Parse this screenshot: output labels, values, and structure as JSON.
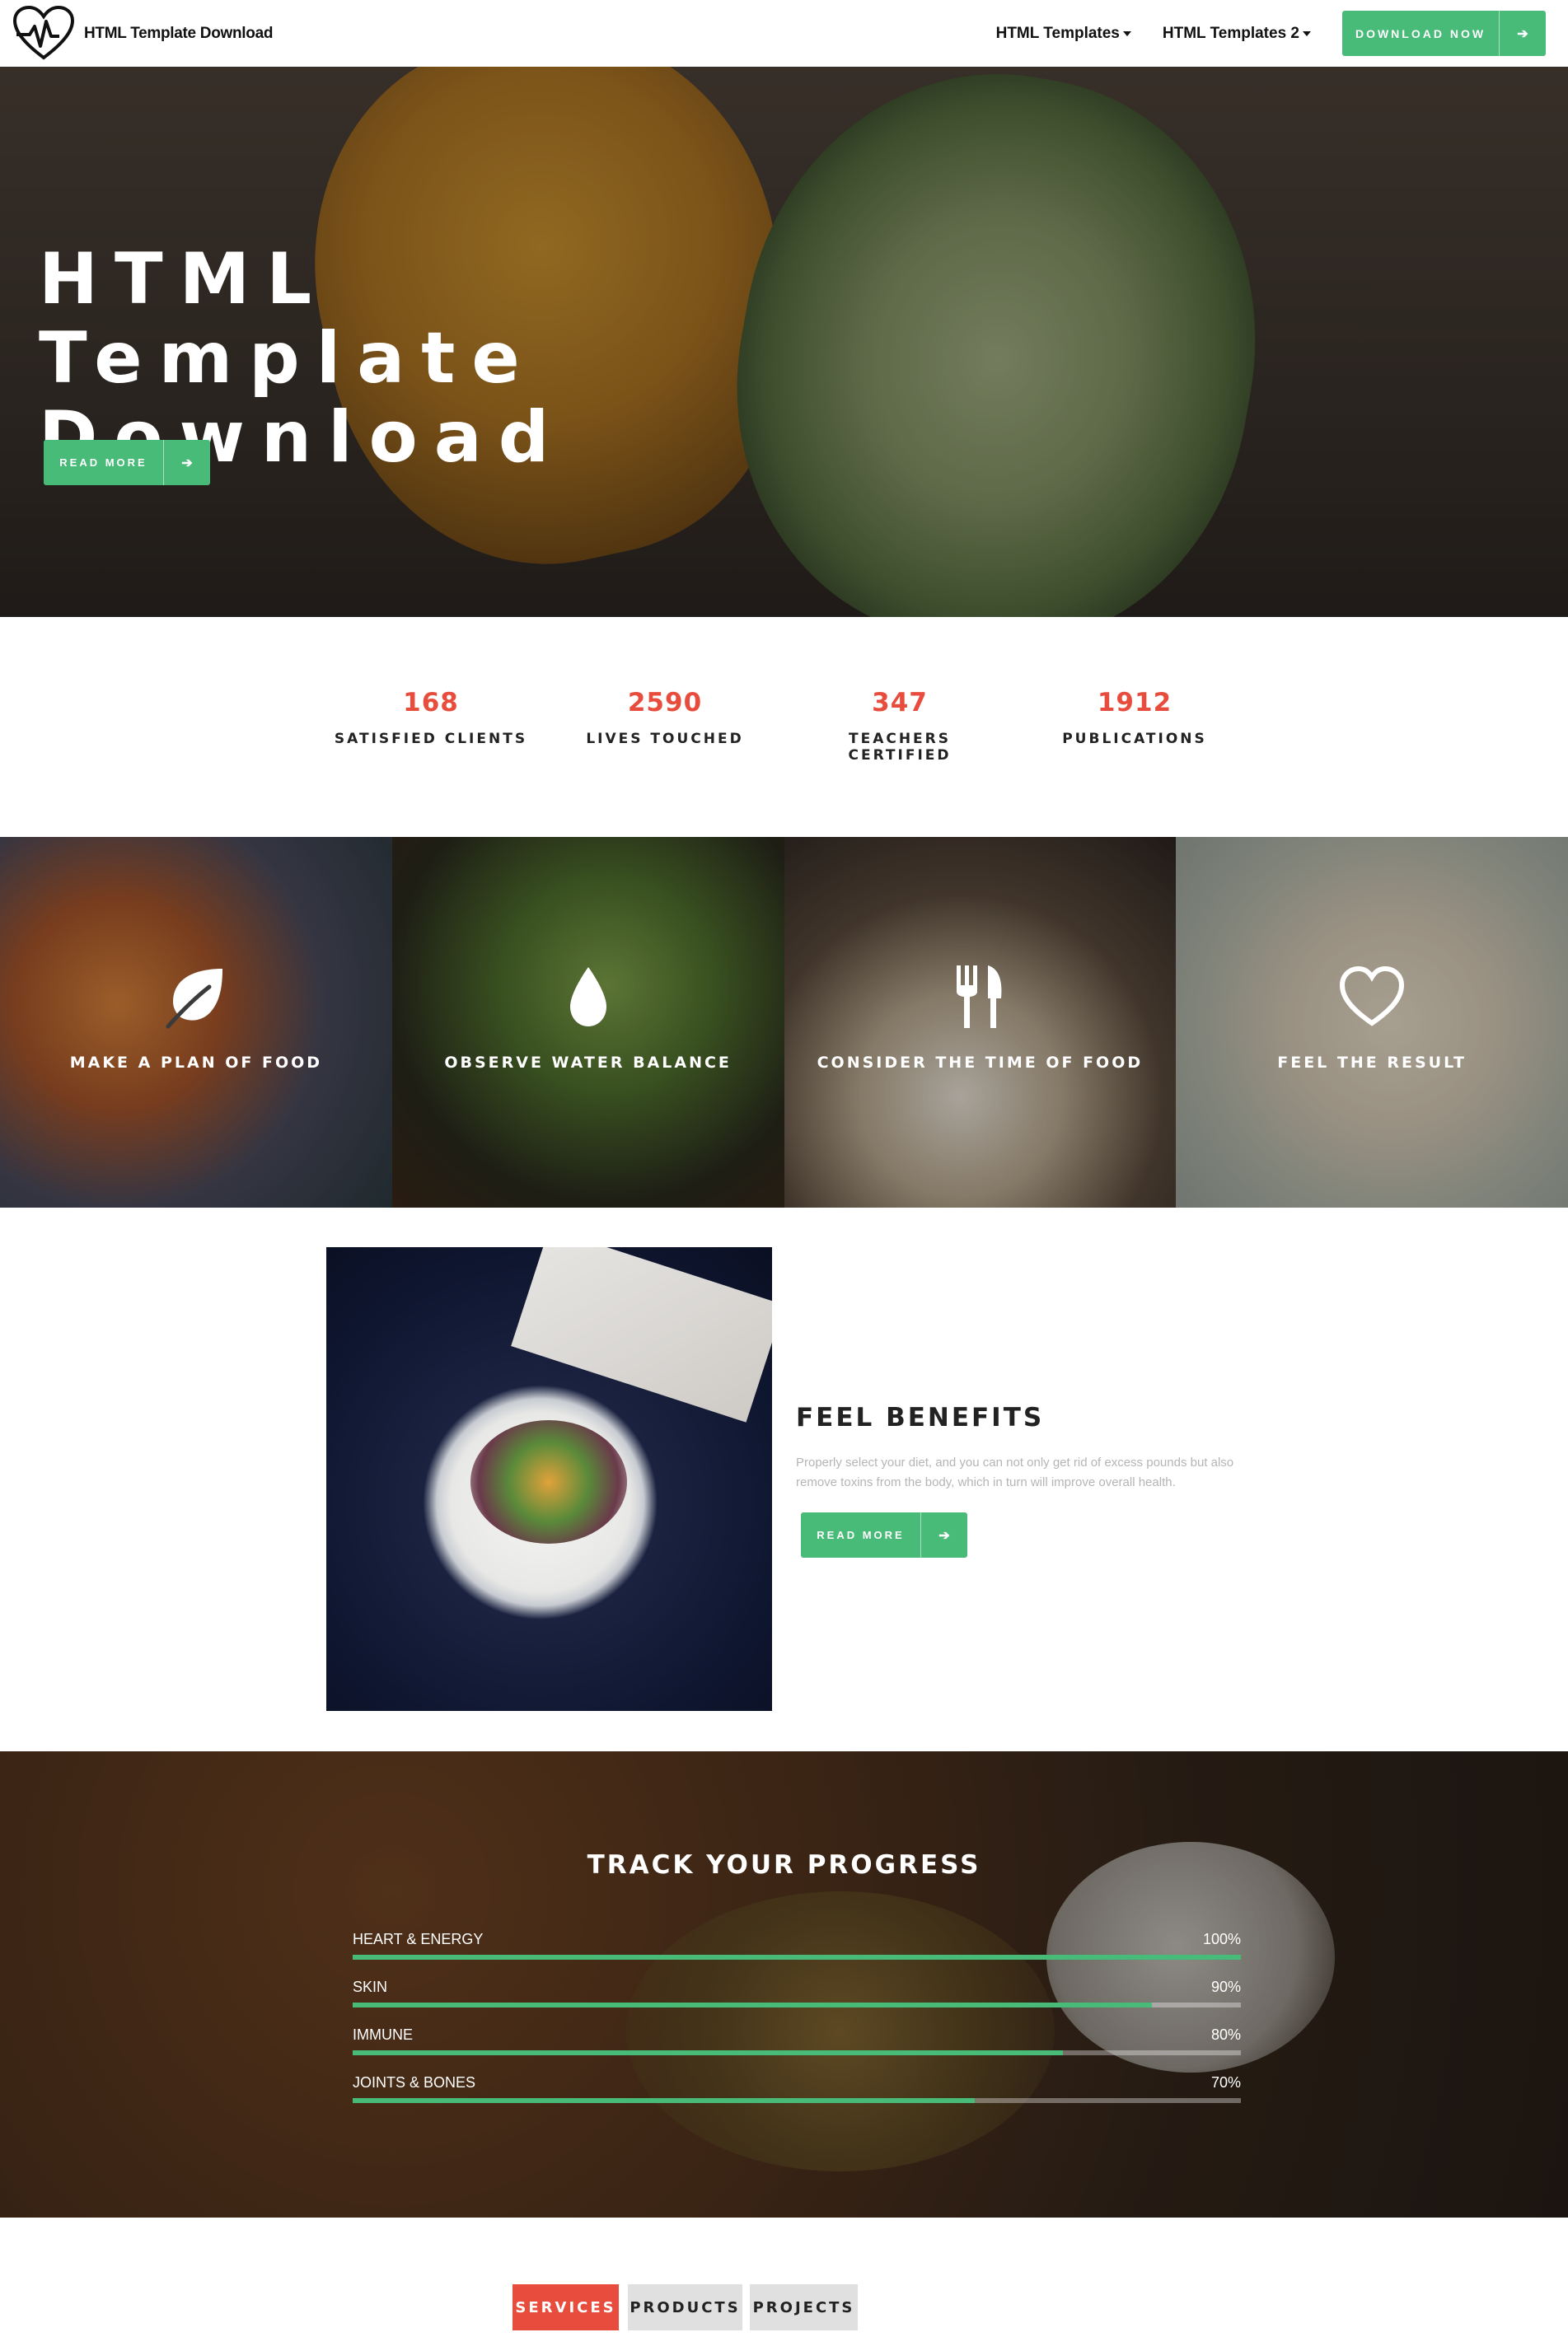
{
  "header": {
    "brand_name": "HTML Template Download",
    "nav": [
      "HTML Templates",
      "HTML Templates 2"
    ],
    "cta_label": "DOWNLOAD NOW"
  },
  "hero": {
    "title_line1": "HTML Template",
    "title_line2": "Download",
    "button_label": "READ MORE"
  },
  "stats": [
    {
      "value": "168",
      "label": "SATISFIED CLIENTS"
    },
    {
      "value": "2590",
      "label": "LIVES TOUCHED"
    },
    {
      "value": "347",
      "label": "TEACHERS CERTIFIED"
    },
    {
      "value": "1912",
      "label": "PUBLICATIONS"
    }
  ],
  "tiles": [
    {
      "label": "MAKE A PLAN OF FOOD",
      "icon": "leaf-icon"
    },
    {
      "label": "OBSERVE WATER BALANCE",
      "icon": "water-drop-icon"
    },
    {
      "label": "CONSIDER THE TIME OF FOOD",
      "icon": "fork-knife-icon"
    },
    {
      "label": "FEEL THE RESULT",
      "icon": "heart-icon"
    }
  ],
  "benefits": {
    "title": "FEEL BENEFITS",
    "text": "Properly select your diet, and you can not only get rid of excess pounds but also remove toxins from the body, which in turn will improve overall health.",
    "button_label": "READ MORE"
  },
  "progress": {
    "title": "TRACK YOUR PROGRESS",
    "bars": [
      {
        "label": "HEART & ENERGY",
        "percent_text": "100%",
        "value": 100
      },
      {
        "label": "SKIN",
        "percent_text": "90%",
        "value": 90
      },
      {
        "label": "IMMUNE",
        "percent_text": "80%",
        "value": 80
      },
      {
        "label": "JOINTS & BONES",
        "percent_text": "70%",
        "value": 70
      }
    ]
  },
  "tabs": [
    "SERVICES",
    "PRODUCTS",
    "PROJECTS"
  ],
  "colors": {
    "accent_green": "#48bb78",
    "accent_red": "#e74c3c"
  }
}
